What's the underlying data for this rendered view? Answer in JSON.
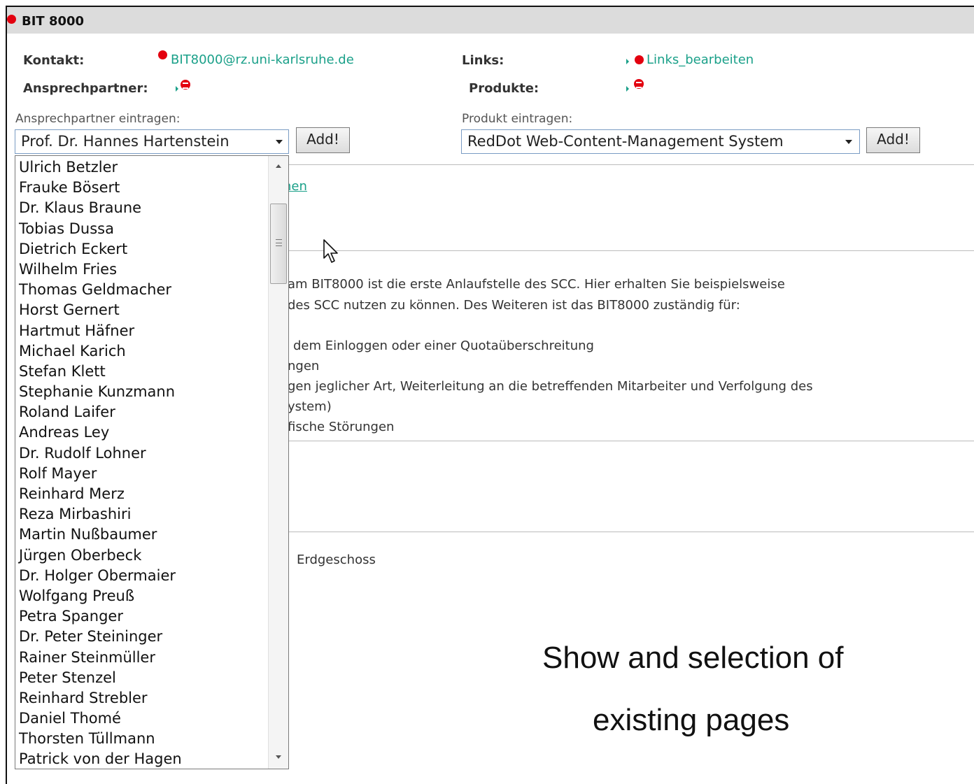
{
  "header": {
    "title": "BIT 8000"
  },
  "contact": {
    "kontakt_label": "Kontakt:",
    "email": "BIT8000@rz.uni-karlsruhe.de",
    "ansprechpartner_label": "Ansprechpartner:",
    "links_label": "Links:",
    "links_edit": "Links_bearbeiten",
    "produkte_label": "Produkte:"
  },
  "contact_form": {
    "label": "Ansprechpartner eintragen:",
    "selected": "Prof. Dr. Hannes Hartenstein",
    "add_label": "Add!",
    "options": [
      "Ulrich Betzler",
      "Frauke Bösert",
      "Dr. Klaus Braune",
      "Tobias Dussa",
      "Dietrich Eckert",
      "Wilhelm Fries",
      "Thomas Geldmacher",
      "Horst Gernert",
      "Hartmut Häfner",
      "Michael Karich",
      "Stefan Klett",
      "Stephanie Kunzmann",
      "Roland Laifer",
      "Andreas Ley",
      "Dr. Rudolf Lohner",
      "Rolf Mayer",
      "Reinhard Merz",
      "Reza Mirbashiri",
      "Martin Nußbaumer",
      "Jürgen Oberbeck",
      "Dr. Holger Obermaier",
      "Wolfgang Preuß",
      "Petra Spanger",
      "Dr. Peter Steininger",
      "Rainer Steinmüller",
      "Peter Stenzel",
      "Reinhard Strebler",
      "Daniel Thomé",
      "Thorsten Tüllmann",
      "Patrick von der Hagen"
    ]
  },
  "product_form": {
    "label": "Produkt eintragen:",
    "selected": "RedDot Web-Content-Management System",
    "add_label": "Add!"
  },
  "background": {
    "link_fragment": "nen",
    "lines": [
      "am BIT8000 ist die erste Anlaufstelle des SCC. Hier erhalten Sie beispielsweise",
      "des SCC nutzen zu können. Des Weiteren ist das BIT8000  zuständig für:",
      "dem Einloggen oder einer Quotaüberschreitung",
      "ngen",
      "gen jeglicher Art, Weiterleitung an die betreffenden Mitarbeiter und Verfolgung des",
      "ystem)",
      "fische Störungen"
    ],
    "location": "Erdgeschoss"
  },
  "caption": {
    "line1": "Show and selection of",
    "line2": "existing pages"
  },
  "colors": {
    "accent_red": "#e3000f",
    "link_green": "#1aa089",
    "header_gray": "#dcdcdc"
  }
}
